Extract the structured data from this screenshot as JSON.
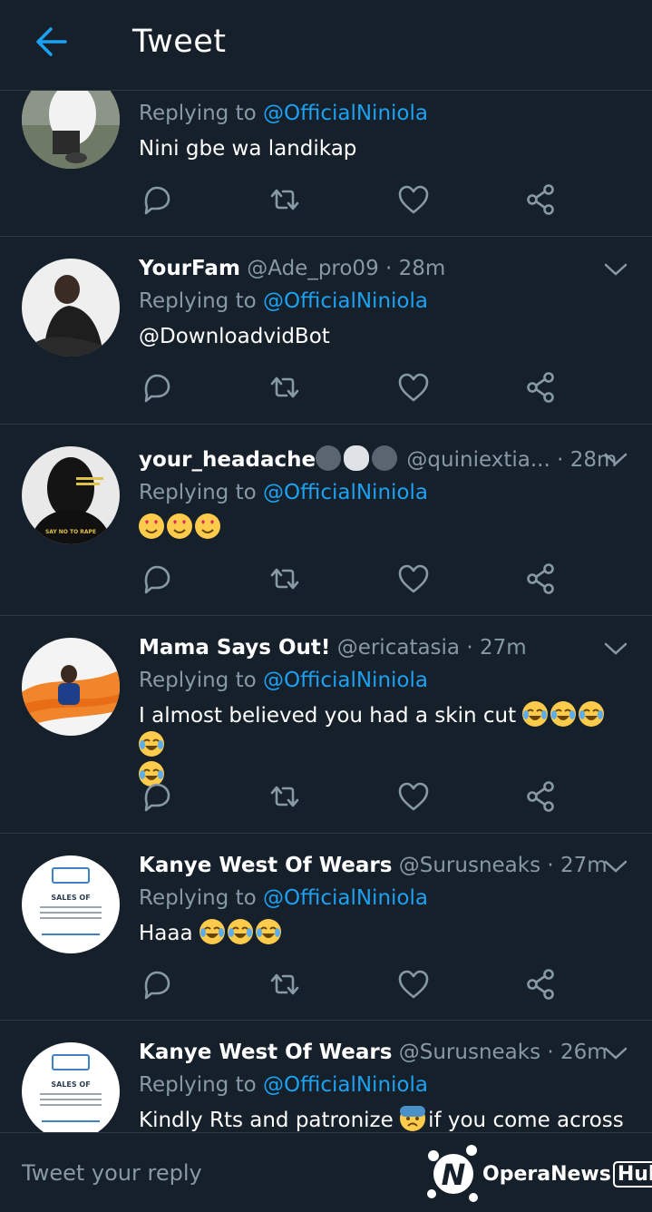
{
  "header": {
    "title": "Tweet"
  },
  "tweets": [
    {
      "name": "",
      "handle": "",
      "time": "",
      "replying_prefix": "Replying to ",
      "replying_to": "@OfficialNiniola",
      "text": "Nini gbe wa landikap",
      "text_is_mention": false
    },
    {
      "name": "YourFam",
      "handle": "@Ade_pro09",
      "dot": "·",
      "time": "28m",
      "replying_prefix": "Replying to ",
      "replying_to": "@OfficialNiniola",
      "text": "@DownloadvidBot",
      "text_is_mention": true
    },
    {
      "name": "your_headache",
      "name_emojis": [
        "dark-face",
        "skull",
        "dark-face"
      ],
      "handle": "@quiniextia...",
      "dot": "·",
      "time": "28m",
      "replying_prefix": "Replying to ",
      "replying_to": "@OfficialNiniola",
      "text": "",
      "text_emojis": [
        "heart-eyes",
        "heart-eyes",
        "heart-eyes"
      ],
      "avatar_caption": "SAY NO TO RAPE"
    },
    {
      "name": "Mama Says Out!",
      "handle": "@ericatasia",
      "dot": "·",
      "time": "27m",
      "replying_prefix": "Replying to ",
      "replying_to": "@OfficialNiniola",
      "text": "I almost believed you had a skin cut",
      "text_emojis": [
        "tears-of-joy",
        "tears-of-joy",
        "tears-of-joy",
        "tears-of-joy",
        "tears-of-joy"
      ]
    },
    {
      "name": "Kanye West Of Wears",
      "handle": "@Surusneaks",
      "dot": "·",
      "time": "27m",
      "replying_prefix": "Replying to ",
      "replying_to": "@OfficialNiniola",
      "text": "Haaa",
      "text_emojis": [
        "tears-of-joy",
        "tears-of-joy",
        "tears-of-joy"
      ],
      "avatar_caption": "SALES OF"
    },
    {
      "name": "Kanye West Of Wears",
      "handle": "@Surusneaks",
      "dot": "·",
      "time": "26m",
      "replying_prefix": "Replying to ",
      "replying_to": "@OfficialNiniola",
      "text": "Kindly Rts and patronize",
      "text_after_emoji": "if you come across",
      "text_emojis": [
        "anxious-sweat"
      ],
      "avatar_caption": "SALES OF"
    }
  ],
  "compose": {
    "placeholder": "Tweet your reply"
  },
  "watermark": {
    "brand": "OperaNews",
    "hub": "Hub"
  },
  "colors": {
    "background": "#15202b",
    "accent": "#1da1f2",
    "muted": "#8899a6",
    "divider": "#2b3945"
  },
  "icons": [
    "back-arrow-icon",
    "reply-icon",
    "retweet-icon",
    "like-icon",
    "share-icon",
    "chevron-down-icon"
  ]
}
